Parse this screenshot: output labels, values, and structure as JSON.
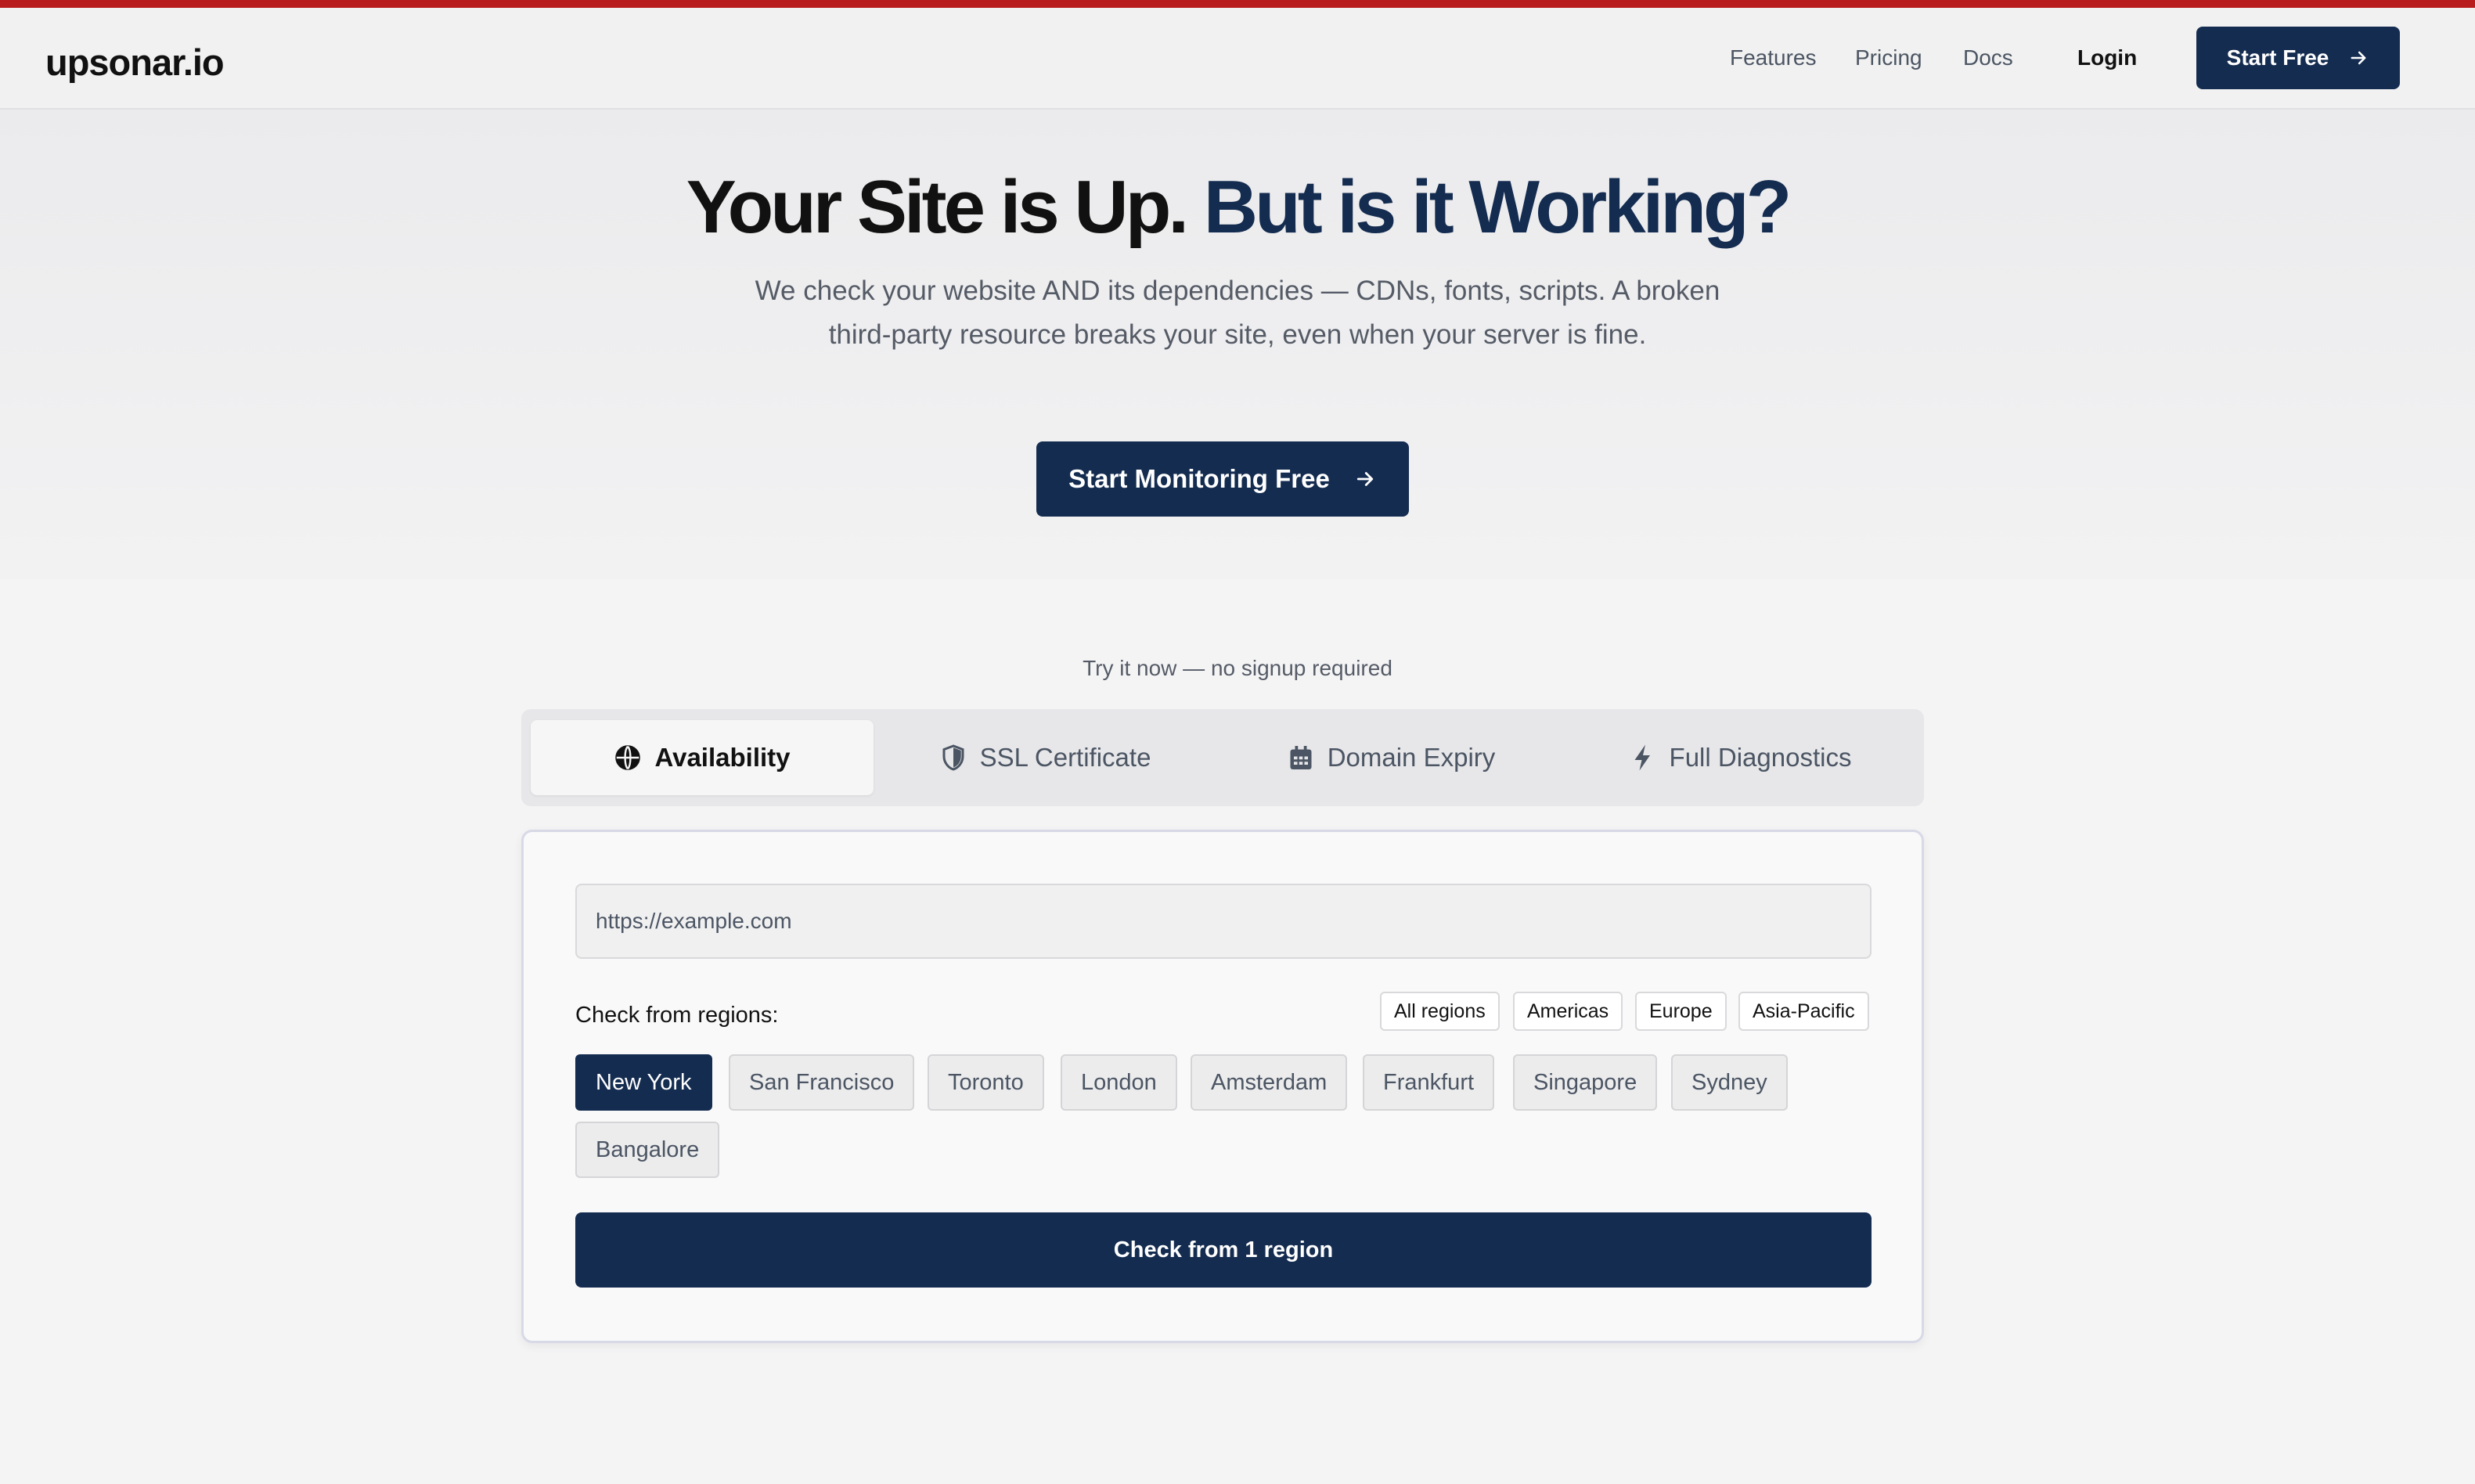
{
  "header": {
    "logo": "upsonar.io",
    "nav": [
      "Features",
      "Pricing",
      "Docs"
    ],
    "login": "Login",
    "start_free": "Start Free"
  },
  "hero": {
    "title_part1": "Your Site is Up.",
    "title_part2": "But is it Working?",
    "subtitle": "We check your website AND its dependencies — CDNs, fonts, scripts. A broken third-party resource breaks your site, even when your server is fine.",
    "cta": "Start Monitoring Free"
  },
  "tryit": {
    "label": "Try it now — no signup required"
  },
  "tabs": [
    {
      "label": "Availability",
      "icon": "globe-icon",
      "active": true
    },
    {
      "label": "SSL Certificate",
      "icon": "shield-icon",
      "active": false
    },
    {
      "label": "Domain Expiry",
      "icon": "calendar-icon",
      "active": false
    },
    {
      "label": "Full Diagnostics",
      "icon": "lightning-icon",
      "active": false
    }
  ],
  "form": {
    "url_placeholder": "https://example.com",
    "regions_label": "Check from regions:",
    "quick_select": [
      "All regions",
      "Americas",
      "Europe",
      "Asia-Pacific"
    ],
    "regions": [
      "New York",
      "San Francisco",
      "Toronto",
      "London",
      "Amsterdam",
      "Frankfurt",
      "Singapore",
      "Sydney",
      "Bangalore"
    ],
    "selected_region": "New York",
    "submit": "Check from 1 region"
  },
  "colors": {
    "brand": "#142c50",
    "accent_bar": "#b91c1c"
  }
}
